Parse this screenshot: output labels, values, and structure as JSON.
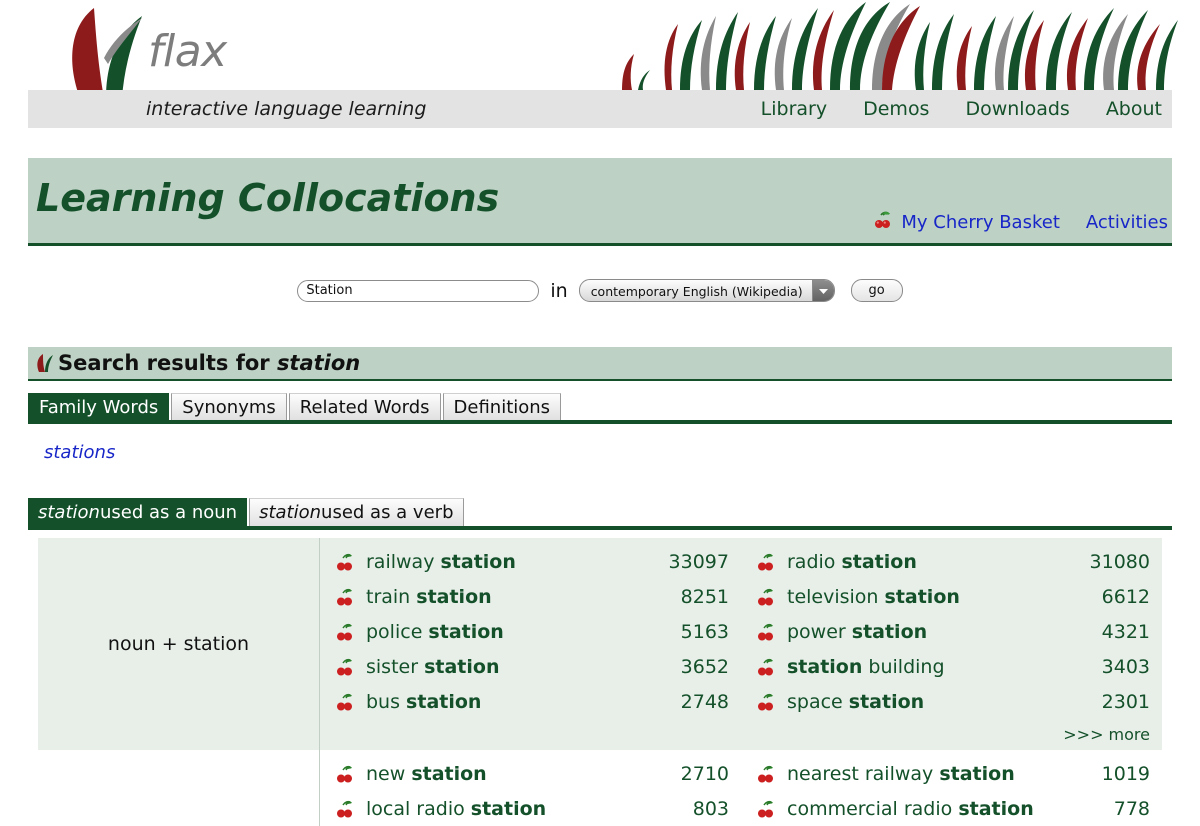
{
  "brand": {
    "name": "flax",
    "tagline": "interactive language learning",
    "logo_icon": "flax-leaf-logo"
  },
  "nav": {
    "items": [
      {
        "label": "Library"
      },
      {
        "label": "Demos"
      },
      {
        "label": "Downloads"
      },
      {
        "label": "About"
      }
    ]
  },
  "page": {
    "title": "Learning Collocations",
    "basket_label": "My Cherry Basket",
    "basket_icon": "cherry-icon",
    "activities_label": "Activities"
  },
  "search": {
    "query": "Station",
    "placeholder": "Search word",
    "in_label": "in",
    "corpus_selected": "contemporary English (Wikipedia)",
    "corpus_options": [
      "contemporary English (Wikipedia)"
    ],
    "dropdown_icon": "chevron-down-icon",
    "go_label": "go"
  },
  "results": {
    "header_prefix": "Search results for",
    "header_term": "station",
    "header_icon": "flax-leaf-icon",
    "tabs": [
      {
        "label": "Family Words",
        "active": true
      },
      {
        "label": "Synonyms",
        "active": false
      },
      {
        "label": "Related Words",
        "active": false
      },
      {
        "label": "Definitions",
        "active": false
      }
    ],
    "family_words": [
      {
        "label": "stations"
      }
    ],
    "pos_tabs": [
      {
        "term": "station",
        "suffix": " used as a noun",
        "active": true
      },
      {
        "term": "station",
        "suffix": " used as a verb",
        "active": false
      }
    ],
    "groups": [
      {
        "label": "noun + station",
        "more_label": ">>> more",
        "left": [
          {
            "pre": "railway ",
            "bold": "station",
            "post": "",
            "freq": "33097"
          },
          {
            "pre": "train ",
            "bold": "station",
            "post": "",
            "freq": "8251"
          },
          {
            "pre": "police ",
            "bold": "station",
            "post": "",
            "freq": "5163"
          },
          {
            "pre": "sister ",
            "bold": "station",
            "post": "",
            "freq": "3652"
          },
          {
            "pre": "bus ",
            "bold": "station",
            "post": "",
            "freq": "2748"
          }
        ],
        "right": [
          {
            "pre": "radio ",
            "bold": "station",
            "post": "",
            "freq": "31080"
          },
          {
            "pre": "television ",
            "bold": "station",
            "post": "",
            "freq": "6612"
          },
          {
            "pre": "power ",
            "bold": "station",
            "post": "",
            "freq": "4321"
          },
          {
            "pre": "",
            "bold": "station",
            "post": " building",
            "freq": "3403"
          },
          {
            "pre": "space ",
            "bold": "station",
            "post": "",
            "freq": "2301"
          }
        ]
      },
      {
        "label": "",
        "more_label": "",
        "left": [
          {
            "pre": "new ",
            "bold": "station",
            "post": "",
            "freq": "2710"
          },
          {
            "pre": "local radio ",
            "bold": "station",
            "post": "",
            "freq": "803"
          }
        ],
        "right": [
          {
            "pre": "nearest railway ",
            "bold": "station",
            "post": "",
            "freq": "1019"
          },
          {
            "pre": "commercial radio ",
            "bold": "station",
            "post": "",
            "freq": "778"
          }
        ]
      }
    ]
  },
  "colors": {
    "brand_green": "#14512a",
    "brand_red": "#8e1b1b",
    "band_green": "#bdd2c5",
    "row_bg": "#e8efe9",
    "link_blue": "#1826c8",
    "nav_bg": "#e3e3e3"
  }
}
